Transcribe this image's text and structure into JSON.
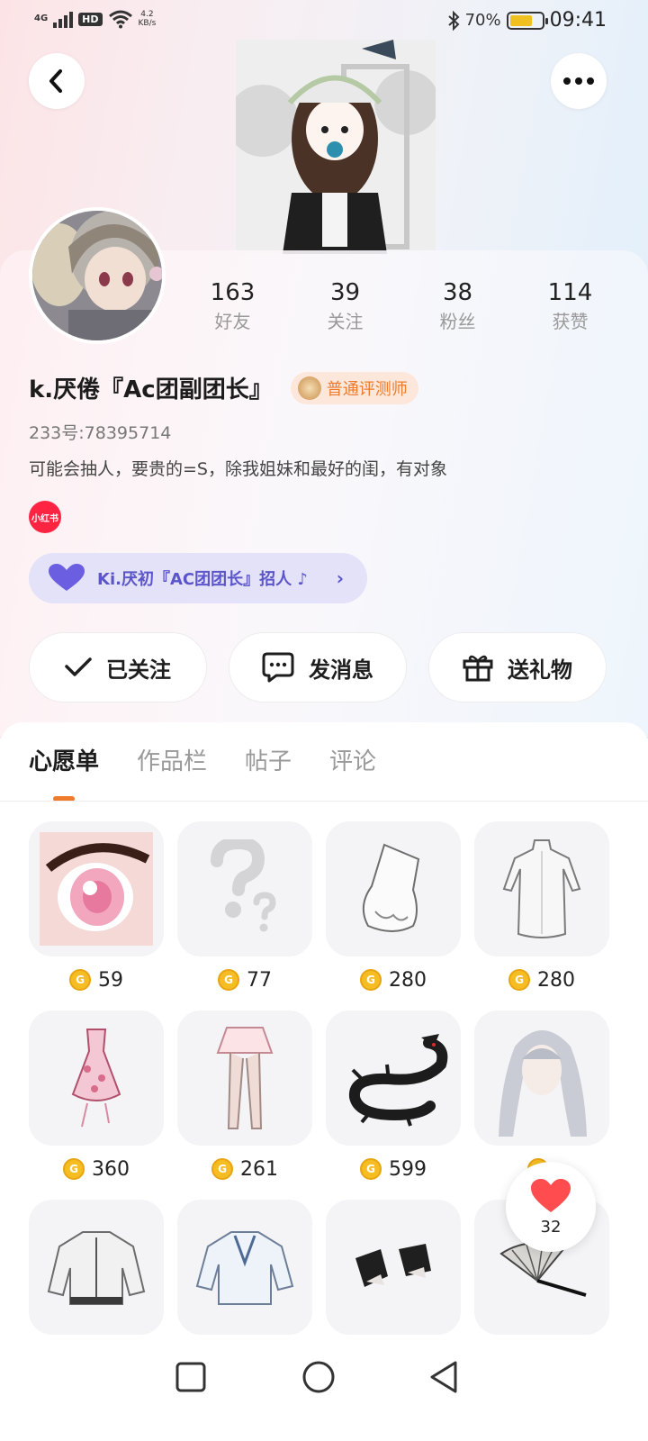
{
  "status_bar": {
    "network": "4G",
    "hd": "HD",
    "speed_value": "4.2",
    "speed_unit": "KB/s",
    "battery": "70%",
    "battery_level": 0.7,
    "time": "09:41"
  },
  "profile": {
    "name": "k.厌倦『Ac团副团长』",
    "badge": "普通评测师",
    "uid": "233号:78395714",
    "bio": "可能会抽人，要贵的=S，除我姐妹和最好的闺，有对象",
    "xhs_label": "小红书",
    "group": "Ki.厌初『AC团团长』招人 ♪",
    "stats": [
      {
        "num": "163",
        "label": "好友"
      },
      {
        "num": "39",
        "label": "关注"
      },
      {
        "num": "38",
        "label": "粉丝"
      },
      {
        "num": "114",
        "label": "获赞"
      }
    ]
  },
  "actions": {
    "follow": "已关注",
    "message": "发消息",
    "gift": "送礼物"
  },
  "tabs": [
    "心愿单",
    "作品栏",
    "帖子",
    "评论"
  ],
  "coin_symbol": "G",
  "wishlist": [
    {
      "price": "59",
      "icon": "anime-eye-icon"
    },
    {
      "price": "77",
      "icon": "question-mark-icon"
    },
    {
      "price": "280",
      "icon": "white-glove-icon"
    },
    {
      "price": "280",
      "icon": "white-dress-icon"
    },
    {
      "price": "360",
      "icon": "pink-dress-icon"
    },
    {
      "price": "261",
      "icon": "skirt-stockings-icon"
    },
    {
      "price": "599",
      "icon": "black-dragon-icon"
    },
    {
      "price": "",
      "icon": "silver-hair-icon"
    },
    {
      "price": "",
      "icon": "hoodie-jacket-icon"
    },
    {
      "price": "",
      "icon": "denim-jacket-icon"
    },
    {
      "price": "",
      "icon": "black-cuffs-icon"
    },
    {
      "price": "",
      "icon": "folding-fan-icon"
    }
  ],
  "like_count": "32",
  "colors": {
    "accent": "#f07a2c",
    "group_pill": "#e3e2f8",
    "group_text": "#5b55c9",
    "coin": "#f6bd23",
    "heart": "#ff4d4f"
  }
}
